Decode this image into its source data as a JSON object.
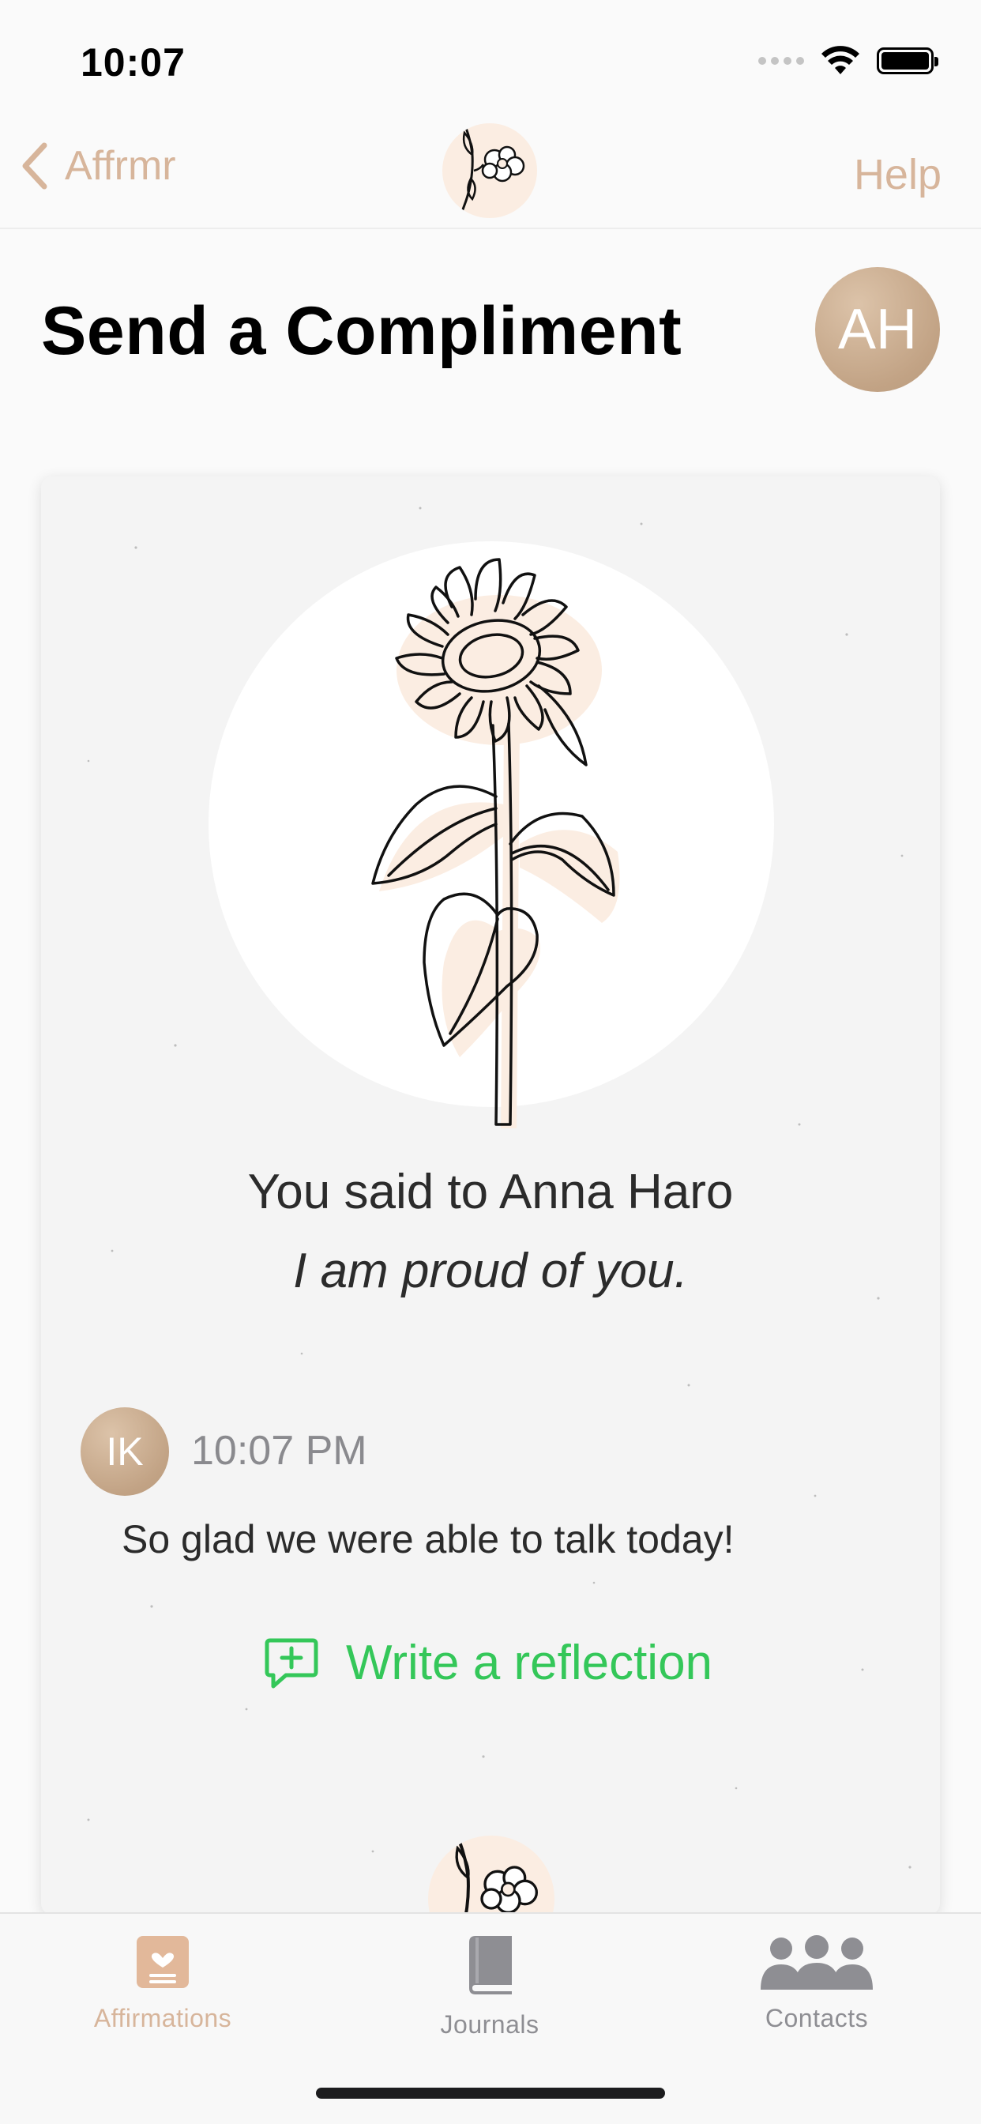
{
  "status_bar": {
    "time": "10:07"
  },
  "nav": {
    "back_label": "Affrmr",
    "help_label": "Help"
  },
  "header": {
    "title": "Send a Compliment",
    "avatar_initials": "AH"
  },
  "card": {
    "said_to": "You said to Anna Haro",
    "message": "I am proud of you.",
    "reply": {
      "avatar_initials": "IK",
      "time": "10:07 PM",
      "text": "So glad we were able to talk today!"
    },
    "action_label": "Write a reflection"
  },
  "tabs": [
    {
      "label": "Affirmations",
      "icon": "affirmations-icon",
      "active": true
    },
    {
      "label": "Journals",
      "icon": "book-icon",
      "active": false
    },
    {
      "label": "Contacts",
      "icon": "people-icon",
      "active": false
    }
  ],
  "colors": {
    "accent": "#d7b59b",
    "green": "#34c759",
    "avatar": "#c9ab8e",
    "logo_bg": "#fbede2"
  }
}
